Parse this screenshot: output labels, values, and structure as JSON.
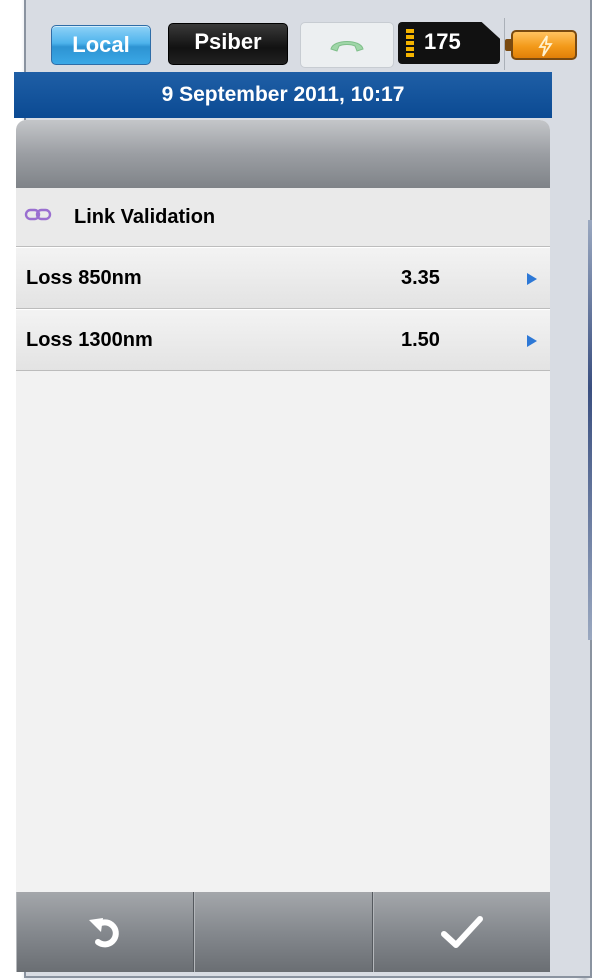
{
  "status_bar": {
    "local_label": "Local",
    "psiber_label": "Psiber",
    "count": "175",
    "phone_icon": "phone-handset-icon",
    "battery_icon": "battery-charging-icon",
    "battery_color": "#f39a1a"
  },
  "header": {
    "datetime": "9 September 2011, 10:17"
  },
  "section": {
    "icon": "link-chain-icon",
    "title": "Link Validation"
  },
  "rows": [
    {
      "label": "Loss 850nm",
      "value": "3.35"
    },
    {
      "label": "Loss 1300nm",
      "value": "1.50"
    }
  ],
  "toolbar": {
    "left_icon": "undo-icon",
    "right_icon": "checkmark-icon"
  },
  "colors": {
    "accent_blue": "#0b4a93",
    "local_button": "#3ba8e6",
    "row_arrow": "#2d78d6"
  }
}
